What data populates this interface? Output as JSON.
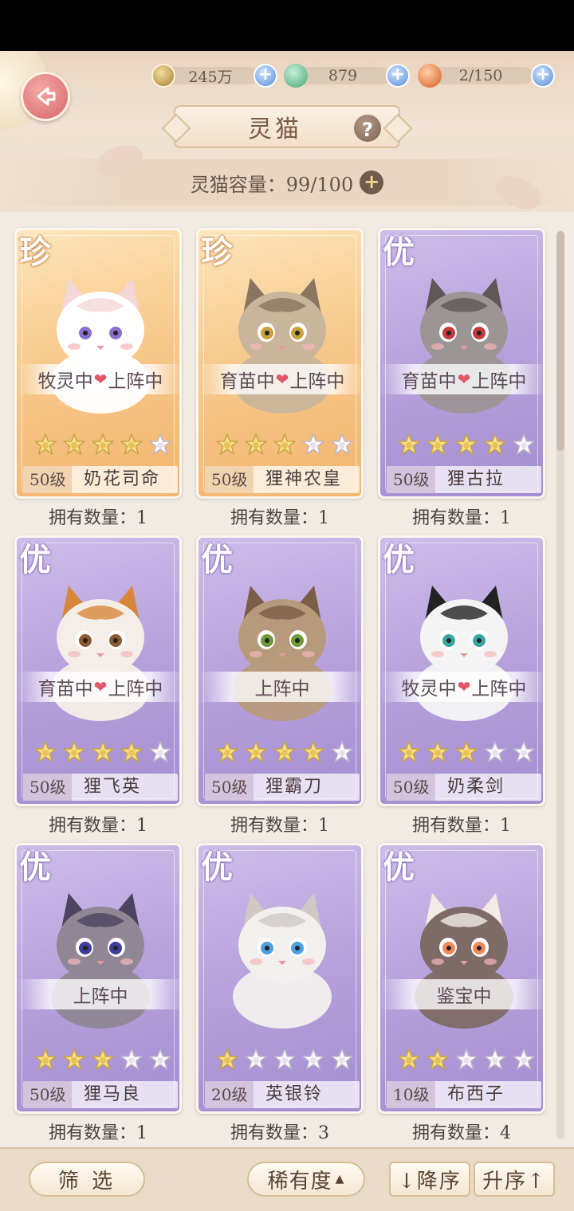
{
  "header": {
    "title": "灵猫",
    "help_label": "?",
    "back_label": "back",
    "capacity_text": "灵猫容量：99/100"
  },
  "resources": [
    {
      "name": "paw-coin",
      "value": "245万"
    },
    {
      "name": "fish",
      "value": "879"
    },
    {
      "name": "mooncake",
      "value": "2/150"
    }
  ],
  "cards": [
    {
      "rarity": "珍",
      "tier": "gold",
      "status": [
        "牧灵中",
        "上阵中"
      ],
      "stars": 4,
      "level": "50级",
      "name": "奶花司命",
      "owned": "拥有数量：1"
    },
    {
      "rarity": "珍",
      "tier": "gold",
      "status": [
        "育苗中",
        "上阵中"
      ],
      "stars": 3,
      "level": "50级",
      "name": "狸神农皇",
      "owned": "拥有数量：1"
    },
    {
      "rarity": "优",
      "tier": "purple",
      "status": [
        "育苗中",
        "上阵中"
      ],
      "stars": 4,
      "level": "50级",
      "name": "狸古拉",
      "owned": "拥有数量：1"
    },
    {
      "rarity": "优",
      "tier": "purple",
      "status": [
        "育苗中",
        "上阵中"
      ],
      "stars": 4,
      "level": "50级",
      "name": "狸飞英",
      "owned": "拥有数量：1"
    },
    {
      "rarity": "优",
      "tier": "purple",
      "status": [
        "上阵中"
      ],
      "stars": 4,
      "level": "50级",
      "name": "狸霸刀",
      "owned": "拥有数量：1"
    },
    {
      "rarity": "优",
      "tier": "purple",
      "status": [
        "牧灵中",
        "上阵中"
      ],
      "stars": 3,
      "level": "50级",
      "name": "奶柔剑",
      "owned": "拥有数量：1"
    },
    {
      "rarity": "优",
      "tier": "purple",
      "status": [
        "上阵中"
      ],
      "stars": 3,
      "level": "50级",
      "name": "狸马良",
      "owned": "拥有数量：1"
    },
    {
      "rarity": "优",
      "tier": "purple",
      "status": [],
      "stars": 1,
      "level": "20级",
      "name": "英银铃",
      "owned": "拥有数量：3"
    },
    {
      "rarity": "优",
      "tier": "purple",
      "status": [
        "鉴宝中"
      ],
      "stars": 2,
      "level": "10级",
      "name": "布西子",
      "owned": "拥有数量：4"
    }
  ],
  "footer": {
    "filter_label": "筛 选",
    "sort_field_label": "稀有度",
    "desc_label": "↓降序",
    "asc_label": "升序↑"
  },
  "colors": {
    "gold_card": "#f7c98c",
    "purple_card": "#b6a1dc",
    "heart": "#e2566a",
    "star_on": "#f6df86",
    "star_off": "#ffffff"
  }
}
